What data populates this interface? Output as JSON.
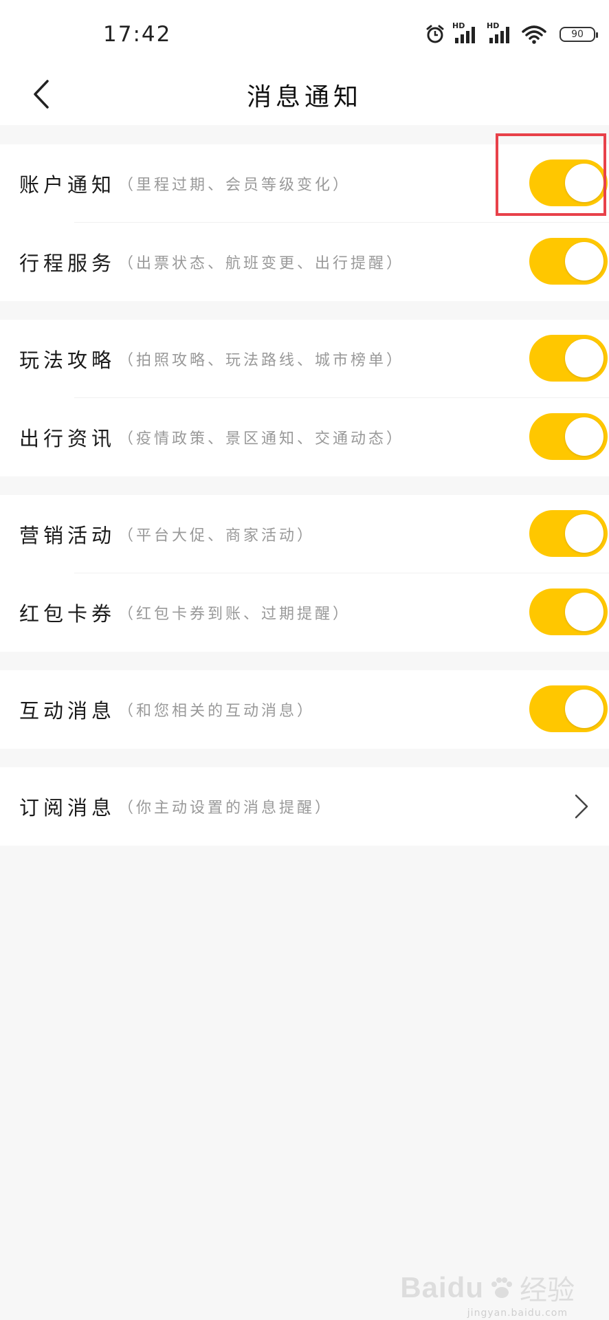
{
  "status_bar": {
    "time": "17:42",
    "icons": [
      "alarm-icon",
      "hd-signal-icon",
      "hd-signal-icon",
      "wifi-icon",
      "battery-icon"
    ],
    "hd_label": "HD",
    "battery_level": "90"
  },
  "header": {
    "title": "消息通知",
    "back_icon": "chevron-left-icon"
  },
  "groups": [
    {
      "items": [
        {
          "title": "账户通知",
          "desc": "（里程过期、会员等级变化）",
          "control": "toggle",
          "on": true
        },
        {
          "title": "行程服务",
          "desc": "（出票状态、航班变更、出行提醒）",
          "control": "toggle",
          "on": true
        }
      ]
    },
    {
      "items": [
        {
          "title": "玩法攻略",
          "desc": "（拍照攻略、玩法路线、城市榜单）",
          "control": "toggle",
          "on": true
        },
        {
          "title": "出行资讯",
          "desc": "（疫情政策、景区通知、交通动态）",
          "control": "toggle",
          "on": true
        }
      ]
    },
    {
      "items": [
        {
          "title": "营销活动",
          "desc": "（平台大促、商家活动）",
          "control": "toggle",
          "on": true
        },
        {
          "title": "红包卡券",
          "desc": "（红包卡券到账、过期提醒）",
          "control": "toggle",
          "on": true
        }
      ]
    },
    {
      "items": [
        {
          "title": "互动消息",
          "desc": "（和您相关的互动消息）",
          "control": "toggle",
          "on": true
        }
      ]
    },
    {
      "items": [
        {
          "title": "订阅消息",
          "desc": "（你主动设置的消息提醒）",
          "control": "chevron",
          "icon": "chevron-right-icon"
        }
      ]
    }
  ],
  "colors": {
    "toggle_on": "#FFC700",
    "highlight": "#e8414a",
    "background": "#f7f7f7"
  },
  "watermark": {
    "logo": "Baidu",
    "sub": "经验",
    "url": "jingyan.baidu.com"
  }
}
